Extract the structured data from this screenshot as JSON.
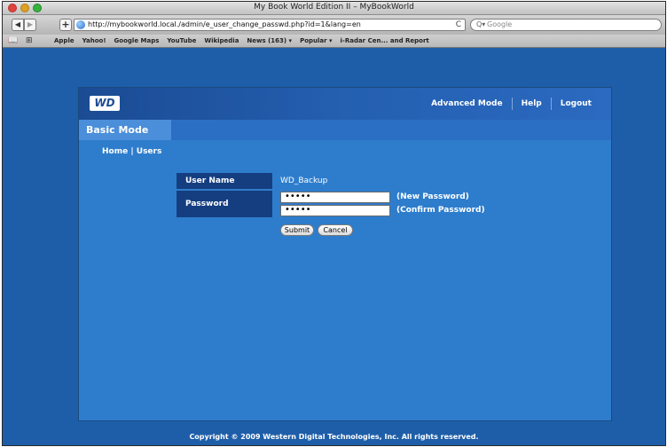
{
  "window": {
    "title": "My Book World Edition II – MyBookWorld"
  },
  "toolbar": {
    "back": "◀",
    "forward": "▶",
    "add": "+",
    "url": "http://mybookworld.local./admin/e_user_change_passwd.php?id=1&lang=en",
    "reload": "C",
    "search_glyph": "Q▾",
    "search_placeholder": "Google"
  },
  "bookmarks": {
    "icons": [
      "book-icon",
      "grid-icon"
    ],
    "items": [
      "Apple",
      "Yahoo!",
      "Google Maps",
      "YouTube",
      "Wikipedia",
      "News (163) ▾",
      "Popular ▾",
      "i-Radar Cen... and Report"
    ]
  },
  "page": {
    "logo": "WD",
    "nav": [
      "Advanced Mode",
      "Help",
      "Logout"
    ],
    "mode_tab": "Basic Mode",
    "breadcrumb": {
      "home": "Home",
      "sep": " | ",
      "users": "Users"
    },
    "form": {
      "user_label": "User Name",
      "user_value": "WD_Backup",
      "password_label": "Password",
      "new_password_value": "•••••",
      "confirm_password_value": "•••••",
      "new_hint": "(New Password)",
      "confirm_hint": "(Confirm Password)",
      "submit": "Submit",
      "cancel": "Cancel"
    },
    "footer": "Copyright © 2009 Western Digital Technologies, Inc. All rights reserved."
  },
  "colors": {
    "page_bg": "#1e5ea8",
    "panel_bg": "#2e7dcc",
    "label_bg": "#153e80",
    "tab_bg": "#4b8ed9"
  }
}
